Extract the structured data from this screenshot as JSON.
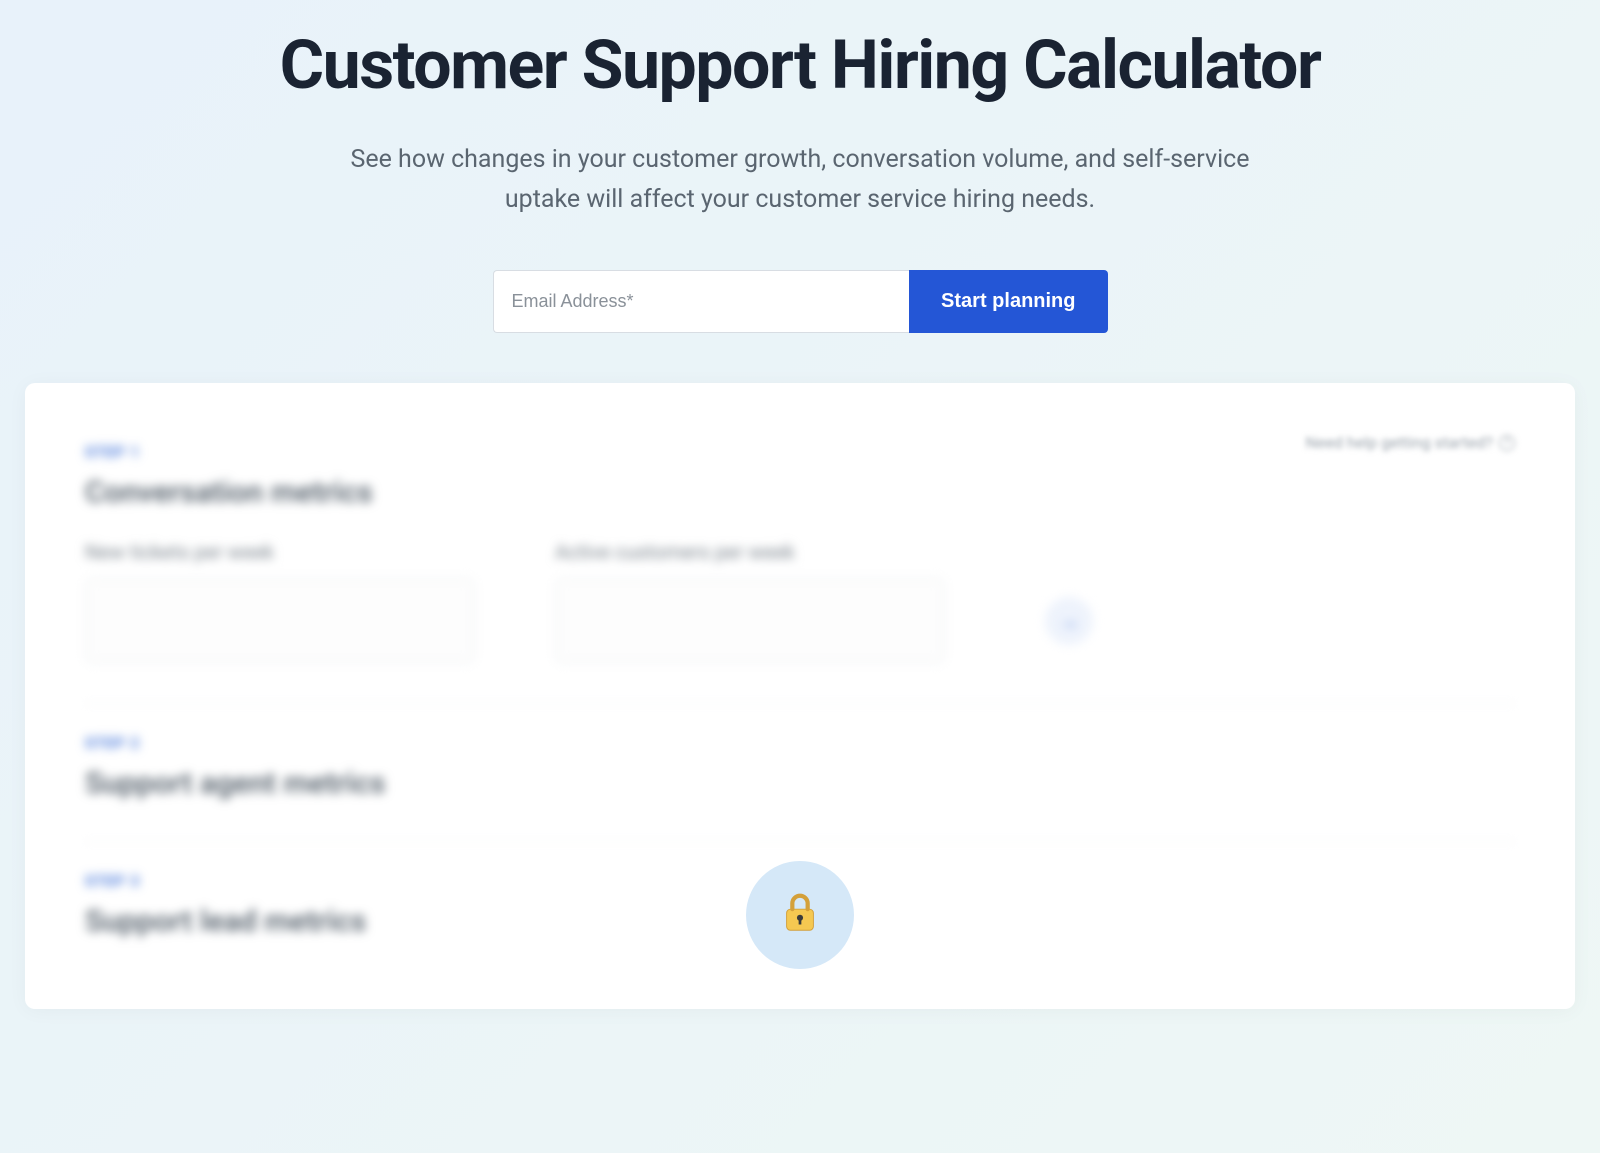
{
  "hero": {
    "title": "Customer Support Hiring Calculator",
    "subtitle": "See how changes in your customer growth, conversation volume, and self-service uptake will affect your customer service hiring needs."
  },
  "form": {
    "email_placeholder": "Email Address*",
    "button_label": "Start planning"
  },
  "card": {
    "help_text": "Need help getting started?",
    "steps": [
      {
        "label": "STEP 1",
        "title": "Conversation metrics",
        "fields": [
          {
            "label": "New tickets per week"
          },
          {
            "label": "Active customers per week"
          }
        ]
      },
      {
        "label": "STEP 2",
        "title": "Support agent metrics"
      },
      {
        "label": "STEP 3",
        "title": "Support lead metrics"
      }
    ]
  }
}
